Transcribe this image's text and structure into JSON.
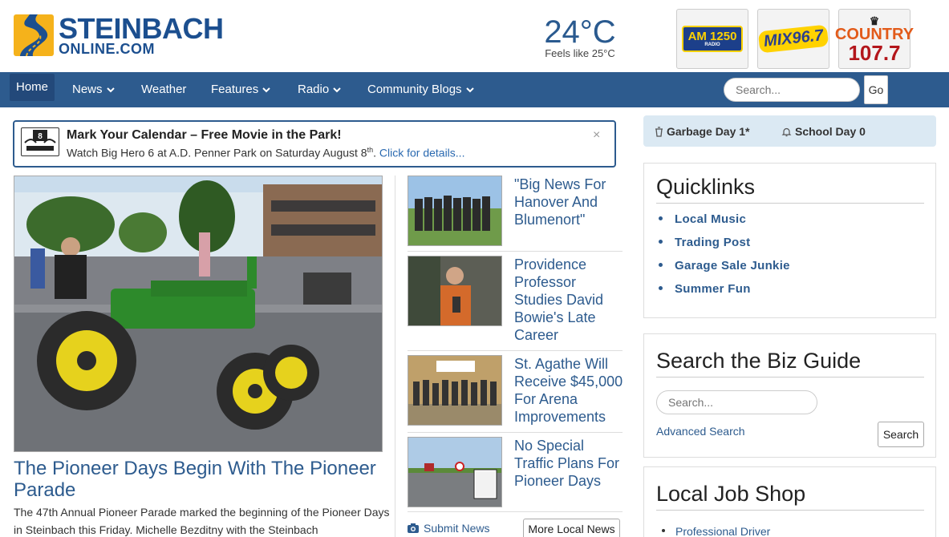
{
  "header": {
    "logo_line1": "STEINBACH",
    "logo_line2": "ONLINE.COM",
    "weather": {
      "temp": "24°C",
      "feels": "Feels like 25°C"
    },
    "stations": [
      {
        "name": "AM 1250",
        "sub": "RADIO"
      },
      {
        "name": "MIX96.7"
      },
      {
        "name_line1": "COUNTRY",
        "name_line2": "107.7"
      }
    ]
  },
  "nav": {
    "items": [
      {
        "label": "Home"
      },
      {
        "label": "News",
        "caret": "⌄"
      },
      {
        "label": "Weather"
      },
      {
        "label": "Features",
        "caret": "⌄"
      },
      {
        "label": "Radio",
        "caret": "⌄"
      },
      {
        "label": "Community Blogs",
        "caret": "⌄"
      }
    ],
    "search_placeholder": "Search...",
    "go_label": "Go"
  },
  "alert": {
    "title": "Mark Your Calendar – Free Movie in the Park!",
    "body": "Watch Big Hero 6 at A.D. Penner Park on Saturday August 8",
    "sup": "th",
    "dot": ".",
    "link": " Click for details...",
    "close": "×"
  },
  "infobar": {
    "garbage": "Garbage Day 1*",
    "school": "School Day 0"
  },
  "feature": {
    "title": "The Pioneer Days Begin With The Pioneer Parade",
    "text": "The 47th Annual Pioneer Parade marked the beginning of the Pioneer Days in Steinbach this Friday. Michelle Bezditny with the Steinbach"
  },
  "news": [
    {
      "title": "\"Big News For Hanover And Blumenort\""
    },
    {
      "title": "Providence Professor Studies David Bowie's Late Career"
    },
    {
      "title": "St. Agathe Will Receive $45,000 For Arena Improvements"
    },
    {
      "title": "No Special Traffic Plans For Pioneer Days"
    }
  ],
  "news_actions": {
    "submit": "Submit News",
    "more": "More Local News"
  },
  "quicklinks": {
    "heading": "Quicklinks",
    "items": [
      "Local Music",
      "Trading Post",
      "Garage Sale Junkie",
      "Summer Fun"
    ]
  },
  "bizguide": {
    "heading": "Search the Biz Guide",
    "placeholder": "Search...",
    "advanced": "Advanced Search",
    "button": "Search"
  },
  "jobshop": {
    "heading": "Local Job Shop",
    "items": [
      "Professional Driver"
    ]
  },
  "colors": {
    "brand_blue": "#2d5b8e",
    "logo_yellow": "#f5b21b",
    "info_bg": "#dbe9f3"
  }
}
